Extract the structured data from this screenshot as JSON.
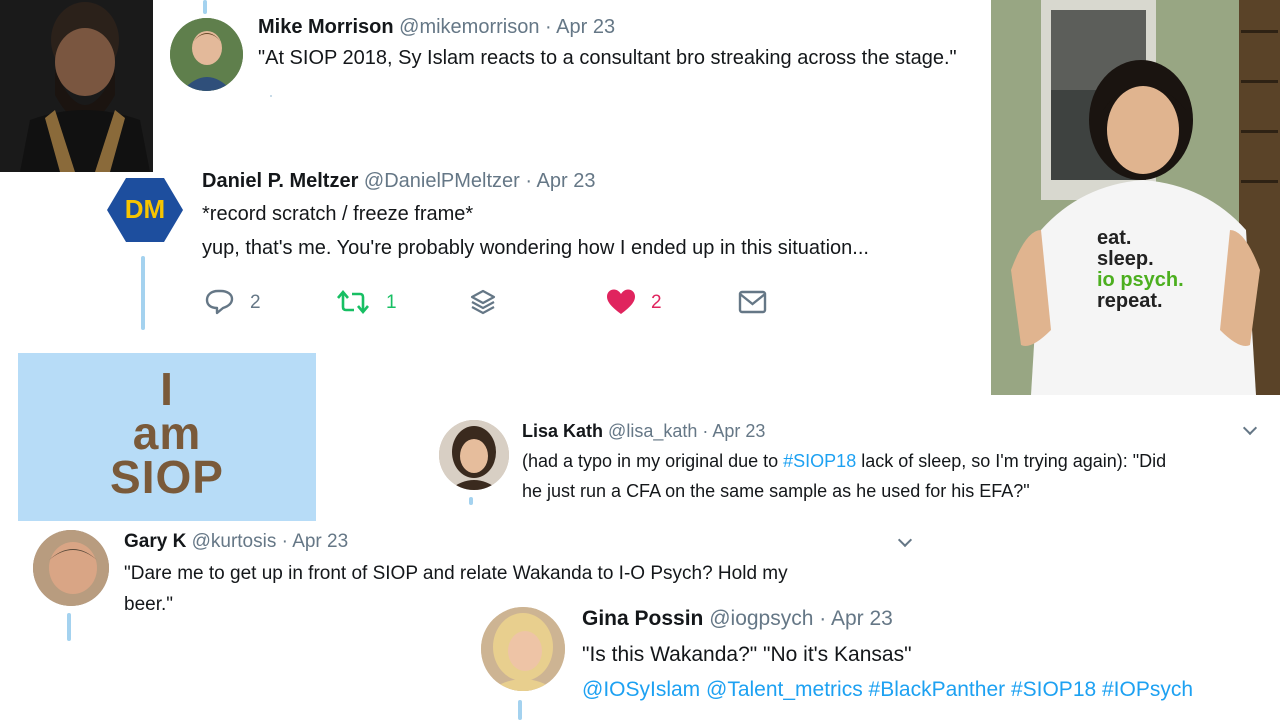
{
  "tweets": {
    "mike": {
      "name": "Mike Morrison",
      "handle": "@mikemorrison",
      "sep": "·",
      "date": "Apr 23",
      "text": "\"At SIOP 2018, Sy Islam reacts to a consultant bro streaking across the stage.\""
    },
    "daniel": {
      "initials": "DM",
      "name": "Daniel P. Meltzer",
      "handle": "@DanielPMeltzer",
      "sep": "·",
      "date": "Apr 23",
      "line1": "*record scratch / freeze frame*",
      "line2": "yup, that's me. You're probably wondering how I ended up in this situation...",
      "actions": {
        "reply_count": "2",
        "retweet_count": "1",
        "like_count": "2"
      }
    },
    "lisa": {
      "name": "Lisa Kath",
      "handle": "@lisa_kath",
      "sep": "·",
      "date": "Apr 23",
      "text_pre": "(had a typo in my original due to ",
      "hashtag": "#SIOP18",
      "text_post": " lack of sleep, so I'm trying again): \"Did",
      "line2": "he just run a CFA on the same sample as he used for his EFA?\""
    },
    "gary": {
      "name": "Gary K",
      "handle": "@kurtosis",
      "sep": "·",
      "date": "Apr 23",
      "line1": "\"Dare me to get up in front of SIOP and relate Wakanda to I-O Psych? Hold my",
      "line2": "beer.\""
    },
    "gina": {
      "name": "Gina Possin",
      "handle": "@iogpsych",
      "sep": "·",
      "date": "Apr 23",
      "line1": "\"Is this Wakanda?\" \"No it's Kansas\"",
      "tags": "@IOSyIslam @Talent_metrics #BlackPanther #SIOP18 #IOPsych"
    }
  },
  "images": {
    "iam_siop": {
      "line1": "I",
      "line2": "am",
      "line3": "SIOP"
    },
    "tshirt": {
      "line1": "eat.",
      "line2": "sleep.",
      "line3": "io psych.",
      "line4": "repeat."
    }
  },
  "colors": {
    "link": "#1da1f2",
    "like": "#e0245e",
    "retweet": "#17bf63",
    "thread": "#a4d2ef",
    "dm_badge": "#1d4e9e",
    "dm_text": "#f7c500"
  }
}
